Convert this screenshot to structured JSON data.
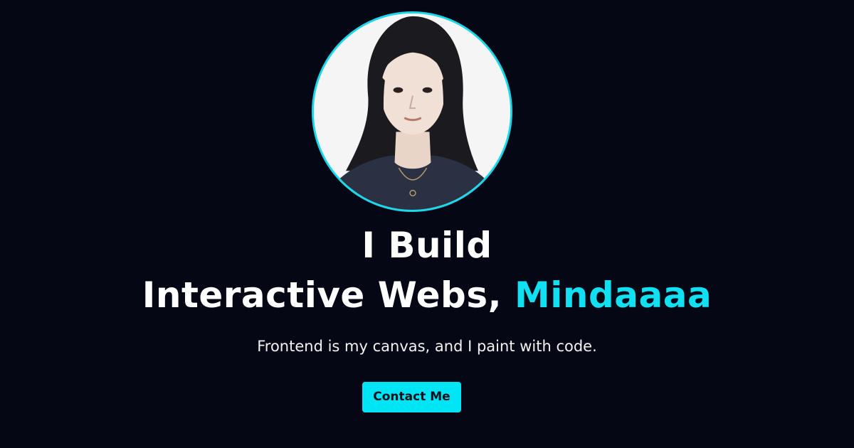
{
  "hero": {
    "avatar_icon": "portrait-photo",
    "headline_line1": "I Build",
    "headline_line2_prefix": "Interactive Webs, ",
    "headline_name": "Mindaaaa",
    "tagline": "Frontend is my canvas, and I paint with code.",
    "cta_label": "Contact Me"
  },
  "colors": {
    "background": "#050814",
    "accent": "#11e0f2",
    "button": "#00e5f5",
    "text": "#ffffff"
  }
}
